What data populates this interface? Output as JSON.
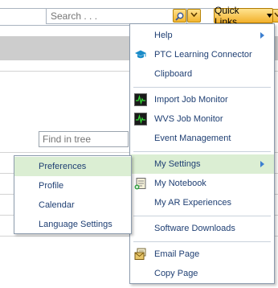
{
  "header": {
    "search_placeholder": "Search . . .",
    "quick_links_label": "Quick Links"
  },
  "page": {
    "find_placeholder": "Find in tree"
  },
  "quick_links_menu": {
    "items": [
      {
        "label": "Help"
      },
      {
        "label": "PTC Learning Connector"
      },
      {
        "label": "Clipboard"
      },
      {
        "label": "Import Job Monitor"
      },
      {
        "label": "WVS Job Monitor"
      },
      {
        "label": "Event Management"
      },
      {
        "label": "My Settings"
      },
      {
        "label": "My Notebook"
      },
      {
        "label": "My AR Experiences"
      },
      {
        "label": "Software Downloads"
      },
      {
        "label": "Email Page"
      },
      {
        "label": "Copy Page"
      }
    ]
  },
  "my_settings_submenu": {
    "items": [
      {
        "label": "Preferences"
      },
      {
        "label": "Profile"
      },
      {
        "label": "Calendar"
      },
      {
        "label": "Language Settings"
      }
    ]
  },
  "colors": {
    "accent_orange": "#f2b02c",
    "menu_text": "#1f3f73",
    "active_row": "#dbeed3"
  }
}
